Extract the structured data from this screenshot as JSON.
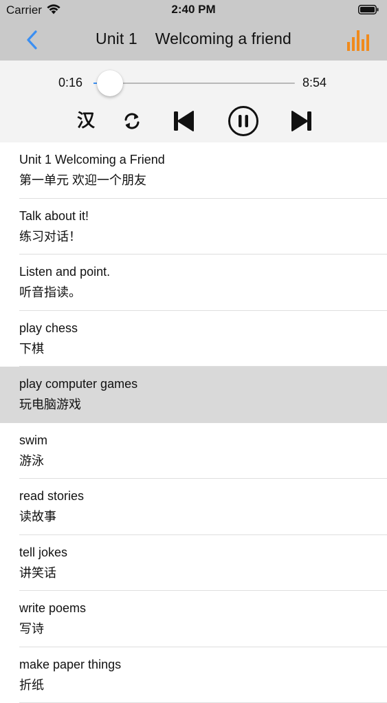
{
  "status_bar": {
    "carrier": "Carrier",
    "time": "2:40 PM"
  },
  "nav": {
    "title": "Unit 1    Welcoming a friend",
    "back_icon": "chevron-left-icon",
    "chart_icon": "bar-chart-icon"
  },
  "player": {
    "current_time": "0:16",
    "total_time": "8:54",
    "progress_fraction": 0.03,
    "translate_label": "汉",
    "repeat_icon": "repeat-icon",
    "prev_icon": "skip-previous-icon",
    "pause_icon": "pause-icon",
    "next_icon": "skip-next-icon"
  },
  "colors": {
    "accent_blue": "#3b8ff2",
    "accent_orange": "#f08a1c",
    "nav_background": "#c9c9c9",
    "player_background": "#f3f3f3",
    "selected_row": "#d9d9d9"
  },
  "items": [
    {
      "en": "Unit 1 Welcoming a Friend",
      "zh": "第一单元 欢迎一个朋友",
      "selected": false
    },
    {
      "en": "Talk about it!",
      "zh": "练习对话！",
      "selected": false
    },
    {
      "en": "Listen and point.",
      "zh": "听音指读。",
      "selected": false
    },
    {
      "en": "play chess",
      "zh": "下棋",
      "selected": false
    },
    {
      "en": "play computer games",
      "zh": "玩电脑游戏",
      "selected": true
    },
    {
      "en": "swim",
      "zh": "游泳",
      "selected": false
    },
    {
      "en": "read stories",
      "zh": "读故事",
      "selected": false
    },
    {
      "en": "tell jokes",
      "zh": "讲笑话",
      "selected": false
    },
    {
      "en": "write poems",
      "zh": "写诗",
      "selected": false
    },
    {
      "en": "make paper things",
      "zh": "折纸",
      "selected": false
    }
  ]
}
